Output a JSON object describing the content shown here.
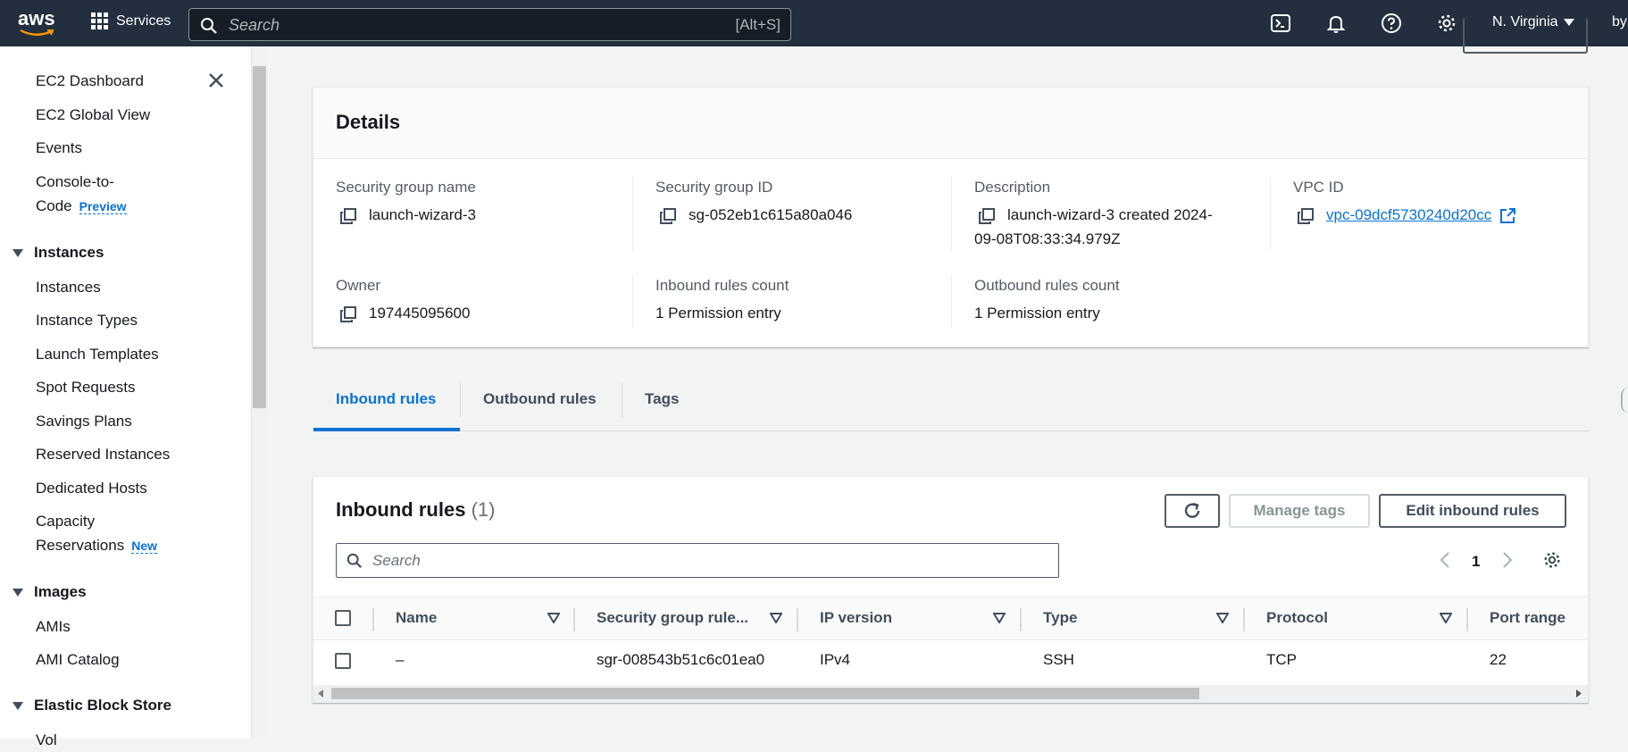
{
  "nav": {
    "logo": "aws",
    "services": "Services",
    "search_placeholder": "Search",
    "search_shortcut": "[Alt+S]",
    "region": "N. Virginia",
    "user_fragment": "by"
  },
  "sidebar": {
    "items_top": [
      "EC2 Dashboard",
      "EC2 Global View",
      "Events"
    ],
    "console_to": "Console-to-",
    "code": "Code",
    "preview_badge": "Preview",
    "instances_section": "Instances",
    "instances_items": [
      "Instances",
      "Instance Types",
      "Launch Templates",
      "Spot Requests",
      "Savings Plans",
      "Reserved Instances",
      "Dedicated Hosts"
    ],
    "capacity": "Capacity",
    "reservations": "Reservations",
    "new_badge": "New",
    "images_section": "Images",
    "images_items": [
      "AMIs",
      "AMI Catalog"
    ],
    "ebs_section": "Elastic Block Store",
    "ebs_fragment": "Vol"
  },
  "details": {
    "title": "Details",
    "sg_name_label": "Security group name",
    "sg_name": "launch-wizard-3",
    "sg_id_label": "Security group ID",
    "sg_id": "sg-052eb1c615a80a046",
    "desc_label": "Description",
    "desc_line1": "launch-wizard-3 created 2024-",
    "desc_line2": "09-08T08:33:34.979Z",
    "vpc_label": "VPC ID",
    "vpc_id": "vpc-09dcf5730240d20cc",
    "owner_label": "Owner",
    "owner": "197445095600",
    "inbound_count_label": "Inbound rules count",
    "inbound_count": "1 Permission entry",
    "outbound_count_label": "Outbound rules count",
    "outbound_count": "1 Permission entry"
  },
  "tabs": [
    "Inbound rules",
    "Outbound rules",
    "Tags"
  ],
  "inbound": {
    "title": "Inbound rules",
    "count": "(1)",
    "manage_tags": "Manage tags",
    "edit_rules": "Edit inbound rules",
    "search_placeholder": "Search",
    "page": "1",
    "columns": [
      "Name",
      "Security group rule...",
      "IP version",
      "Type",
      "Protocol",
      "Port range"
    ],
    "rows": [
      {
        "name": "–",
        "rule_id": "sgr-008543b51c6c01ea0",
        "ip_version": "IPv4",
        "type": "SSH",
        "protocol": "TCP",
        "port_range": "22"
      }
    ]
  },
  "colors": {
    "nav_bg": "#232f3e",
    "link": "#0972d3",
    "accent": "#0972d3"
  }
}
